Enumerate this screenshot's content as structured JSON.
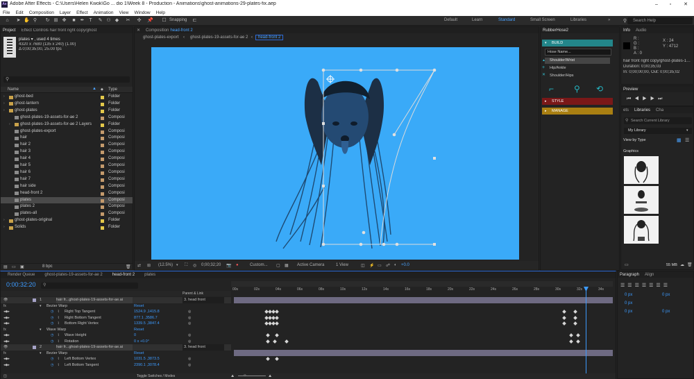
{
  "window": {
    "title": "Adobe After Effects - C:\\Users\\Helen Kwok\\Go ... dio 1\\Week 8 - Production - Animations\\ghost-animations-29-plates-fix.aep",
    "logo": "Ae"
  },
  "menu": [
    "File",
    "Edit",
    "Composition",
    "Layer",
    "Effect",
    "Animation",
    "View",
    "Window",
    "Help"
  ],
  "toolbar": {
    "snapping": "Snapping",
    "workspaces": [
      "Default",
      "Learn",
      "Standard",
      "Small Screen",
      "Libraries"
    ],
    "active_workspace": "Standard",
    "search_placeholder": "Search Help"
  },
  "project": {
    "tabs": [
      "Project",
      "Effect Controls hair front right copy/ghost"
    ],
    "thumb_name": "plates ▾ , used 4 times",
    "thumb_info1": "4320 x 7680 (135 x 240) (1.00)",
    "thumb_info2": "Δ 0;00;35;00, 25.00 fps",
    "col_name": "Name",
    "col_type": "Type",
    "items": [
      {
        "name": "ghost-bed",
        "type": "Folder",
        "kind": "folder",
        "indent": 0
      },
      {
        "name": "ghost-lantern",
        "type": "Folder",
        "kind": "folder",
        "indent": 0
      },
      {
        "name": "ghost-plates",
        "type": "Folder",
        "kind": "folder",
        "indent": 0
      },
      {
        "name": "ghost-plates-19-assets-for-ae 2",
        "type": "Composi",
        "kind": "comp",
        "indent": 1
      },
      {
        "name": "ghost-plates-19-assets-for-ae 2 Layers",
        "type": "Folder",
        "kind": "folder",
        "indent": 1
      },
      {
        "name": "ghost-plates-export",
        "type": "Composi",
        "kind": "comp",
        "indent": 1
      },
      {
        "name": "hair",
        "type": "Composi",
        "kind": "comp",
        "indent": 1
      },
      {
        "name": "hair 2",
        "type": "Composi",
        "kind": "comp",
        "indent": 1
      },
      {
        "name": "hair 3",
        "type": "Composi",
        "kind": "comp",
        "indent": 1
      },
      {
        "name": "hair 4",
        "type": "Composi",
        "kind": "comp",
        "indent": 1
      },
      {
        "name": "hair 5",
        "type": "Composi",
        "kind": "comp",
        "indent": 1
      },
      {
        "name": "hair 6",
        "type": "Composi",
        "kind": "comp",
        "indent": 1
      },
      {
        "name": "hair 7",
        "type": "Composi",
        "kind": "comp",
        "indent": 1
      },
      {
        "name": "hair side",
        "type": "Composi",
        "kind": "comp",
        "indent": 1
      },
      {
        "name": "head-front 2",
        "type": "Composi",
        "kind": "comp",
        "indent": 1
      },
      {
        "name": "plates",
        "type": "Composi",
        "kind": "comp",
        "indent": 1,
        "selected": true
      },
      {
        "name": "plates 2",
        "type": "Composi",
        "kind": "comp",
        "indent": 1
      },
      {
        "name": "plates-all",
        "type": "Composi",
        "kind": "comp",
        "indent": 1
      },
      {
        "name": "ghost-plates-original",
        "type": "Folder",
        "kind": "folder",
        "indent": 0
      },
      {
        "name": "Solids",
        "type": "Folder",
        "kind": "folder",
        "indent": 0
      }
    ],
    "bpc": "8 bpc"
  },
  "composition": {
    "tab_label": "Composition",
    "tab_name": "head-front 2",
    "breadcrumbs": [
      "ghost-plates-export",
      "ghost-plates-19-assets-for-ae 2",
      "head-front 2"
    ],
    "zoom": "(12.5%)",
    "timecode": "0;00;32;20",
    "resolution": "Custom...",
    "camera": "Active Camera",
    "views": "1 View",
    "exposure": "+0.0"
  },
  "rubberhose": {
    "title": "RubberHose2",
    "build": "BUILD",
    "hose_name_placeholder": "Hose Name...",
    "options": [
      "Shoulder/Wrist",
      "Hip/Ankle",
      "Shoulder/Hips"
    ],
    "style": "STYLE",
    "manage": "MANAGE"
  },
  "info": {
    "tabs": [
      "Info",
      "Audio"
    ],
    "r": "R :",
    "g": "G :",
    "b": "B :",
    "a": "A : 0",
    "x": "X : 24",
    "y": "Y : 4712",
    "layer": "hair front right copy/ghost-plates-19-assets",
    "duration": "Duration: 0;00;35;03",
    "in_out": "In: 0;00;00;00, Out: 0;00;35;02"
  },
  "preview": {
    "title": "Preview"
  },
  "libraries": {
    "tabs": [
      "ets",
      "Libraries",
      "Cha"
    ],
    "search_placeholder": "Search Current Library",
    "library": "My Library",
    "view_by": "View by Type",
    "section": "Graphics",
    "size_label": "55 MB"
  },
  "timeline": {
    "tabs": [
      "Render Queue",
      "ghost-plates-19-assets-for-ae 2",
      "head-front 2",
      "plates"
    ],
    "timecode": "0:00:32:20",
    "col_parent": "Parent & Link",
    "ruler": [
      "00s",
      "02s",
      "04s",
      "06s",
      "08s",
      "10s",
      "12s",
      "14s",
      "16s",
      "18s",
      "20s",
      "22s",
      "24s",
      "26s",
      "28s",
      "30s",
      "32s",
      "34s"
    ],
    "rows": [
      {
        "kind": "layer",
        "num": "1",
        "name": "hair fr...ghost-plates-19-assets-for-ae.ai",
        "parent": "3. head front"
      },
      {
        "kind": "effect",
        "name": "Bezier Warp",
        "value": "Reset"
      },
      {
        "kind": "prop",
        "name": "Right Top Tangent",
        "value": "1524.9 ,1415.8"
      },
      {
        "kind": "prop",
        "name": "Right Bottom Tangent",
        "value": "877.1 ,3586.7"
      },
      {
        "kind": "prop",
        "name": "Bottom Right Vertex",
        "value": "1339.5 ,3847.4"
      },
      {
        "kind": "effect",
        "name": "Wave Warp",
        "value": "Reset"
      },
      {
        "kind": "prop",
        "name": "Wave Height",
        "value": "0"
      },
      {
        "kind": "prop",
        "name": "Rotation",
        "value": "0 x +0.0°"
      },
      {
        "kind": "layer",
        "num": "2",
        "name": "hair fr...ghost-plates-19-assets-for-ae.ai",
        "parent": "3. head front"
      },
      {
        "kind": "effect",
        "name": "Bezier Warp",
        "value": "Reset"
      },
      {
        "kind": "prop",
        "name": "Left Bottom Vertex",
        "value": "1031.5 ,3873.5"
      },
      {
        "kind": "prop",
        "name": "Left Bottom Tangent",
        "value": "2390.1 ,3078.4"
      }
    ],
    "footer": "Toggle Switches / Modes"
  },
  "paragraph": {
    "tabs": [
      "Paragraph",
      "Align"
    ],
    "values": [
      "0 px",
      "0 px",
      "0 px",
      "0 px",
      "0 px"
    ]
  },
  "colors": {
    "viewer_bg": "#3aaaf8",
    "accent": "#2d8ceb",
    "rubberhose_teal": "#2aa6a6",
    "rubberhose_red": "#8a1b1b",
    "rubberhose_yellow": "#b88d14",
    "timecode_blue": "#3d9bff",
    "selected_row": "#4a4a4a"
  }
}
